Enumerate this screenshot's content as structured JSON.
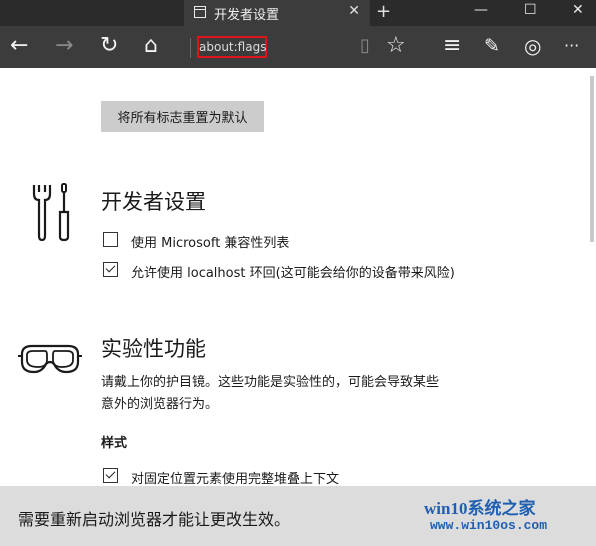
{
  "tab": {
    "title": "开发者设置",
    "close": "✕"
  },
  "new_tab": "+",
  "window": {
    "minimize": "—",
    "maximize": "☐",
    "close": "✕"
  },
  "toolbar": {
    "back": "←",
    "forward": "→",
    "refresh": "↻",
    "home": "⌂",
    "address": "about:flags",
    "reading": "▯",
    "favorite": "☆",
    "hub": "≡",
    "note": "✎",
    "share": "◎",
    "more": "···"
  },
  "reset_button": "将所有标志重置为默认",
  "developer": {
    "title": "开发者设置",
    "options": [
      {
        "label": "使用 Microsoft 兼容性列表",
        "checked": false
      },
      {
        "label": "允许使用 localhost 环回(这可能会给你的设备带来风险)",
        "checked": true
      }
    ]
  },
  "experimental": {
    "title": "实验性功能",
    "description_line1": "请戴上你的护目镜。这些功能是实验性的，可能会导致某些",
    "description_line2": "意外的浏览器行为。",
    "style_heading": "样式",
    "style_option": {
      "label": "对固定位置元素使用完整堆叠上下文",
      "checked": true
    }
  },
  "restart_notice": "需要重新启动浏览器才能让更改生效。",
  "watermark": {
    "line1": "win10系统之家",
    "line2": "www.win10os.com"
  }
}
